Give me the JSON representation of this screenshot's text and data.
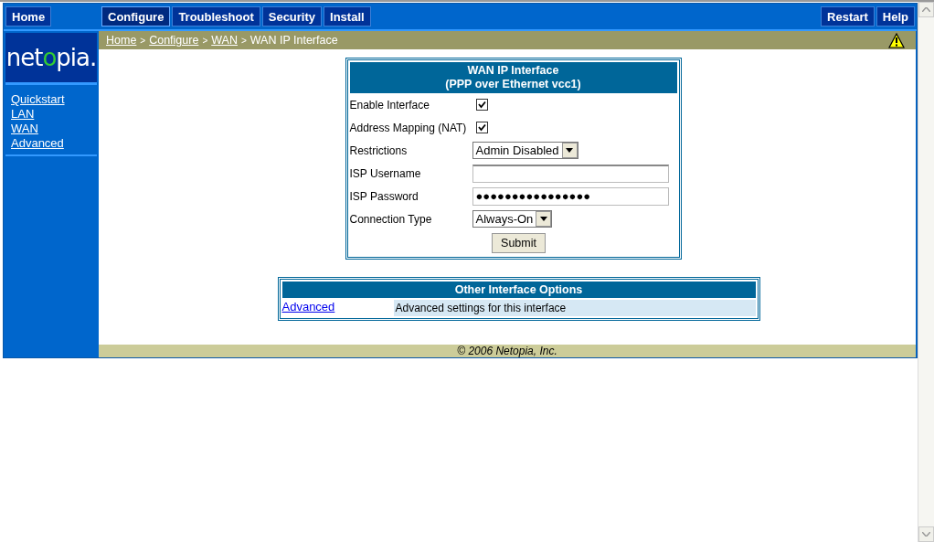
{
  "top_nav": {
    "left": [
      {
        "label": "Home",
        "selected": false
      }
    ],
    "center": [
      {
        "label": "Configure",
        "selected": true
      },
      {
        "label": "Troubleshoot",
        "selected": false
      },
      {
        "label": "Security",
        "selected": false
      },
      {
        "label": "Install",
        "selected": false
      }
    ],
    "right": [
      {
        "label": "Restart",
        "selected": false
      },
      {
        "label": "Help",
        "selected": false
      }
    ]
  },
  "sidebar": {
    "logo": "netopia.",
    "items": [
      {
        "label": "Quickstart"
      },
      {
        "label": "LAN"
      },
      {
        "label": "WAN"
      },
      {
        "label": "Advanced"
      }
    ]
  },
  "breadcrumb": {
    "links": [
      "Home",
      "Configure",
      "WAN"
    ],
    "separator": ">",
    "current": "WAN IP Interface",
    "warning": true
  },
  "form": {
    "title": "WAN IP Interface",
    "subtitle": "(PPP over Ethernet vcc1)",
    "fields": [
      {
        "kind": "checkbox",
        "label": "Enable Interface",
        "checked": true
      },
      {
        "kind": "checkbox",
        "label": "Address Mapping (NAT)",
        "checked": true
      },
      {
        "kind": "select",
        "label": "Restrictions",
        "value": "Admin Disabled"
      },
      {
        "kind": "text",
        "label": "ISP Username"
      },
      {
        "kind": "password",
        "label": "ISP Password",
        "value": "●●●●●●●●●●●●●●●●"
      },
      {
        "kind": "select",
        "label": "Connection Type",
        "value": "Always-On"
      }
    ],
    "submit": "Submit"
  },
  "other_options": {
    "title": "Other Interface Options",
    "rows": [
      {
        "link": "Advanced",
        "description": "Advanced settings for this interface"
      }
    ]
  },
  "footer": "© 2006 Netopia, Inc."
}
